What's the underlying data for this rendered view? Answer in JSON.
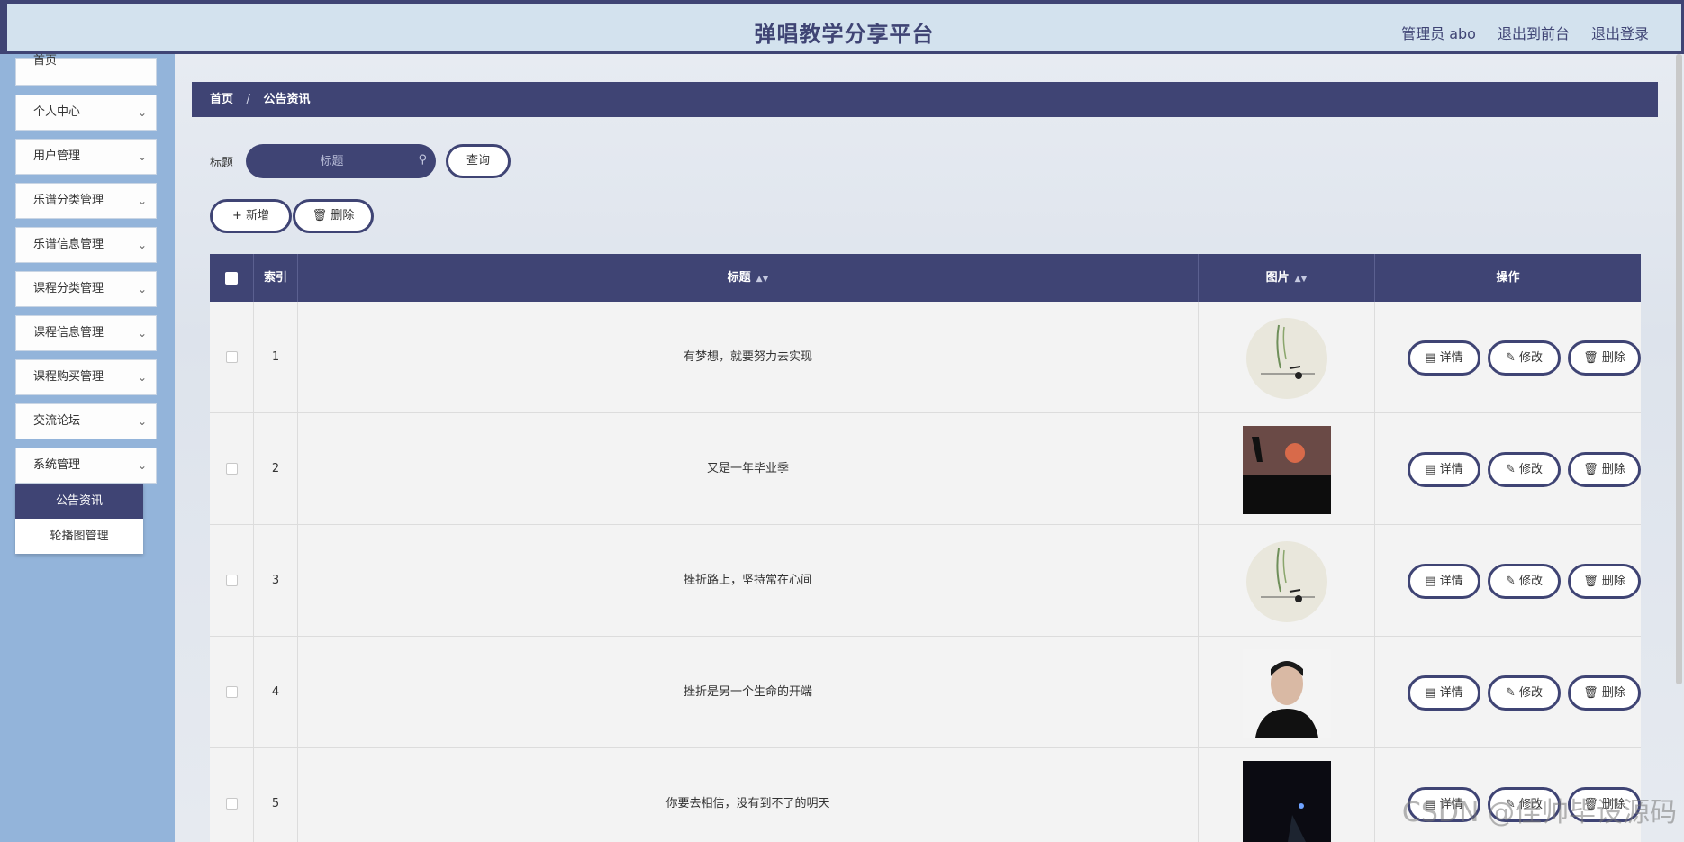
{
  "header": {
    "title": "弹唱教学分享平台",
    "user": "管理员 abo",
    "link_front": "退出到前台",
    "link_logout": "退出登录"
  },
  "sidebar": {
    "items": [
      {
        "label": "首页"
      },
      {
        "label": "个人中心"
      },
      {
        "label": "用户管理"
      },
      {
        "label": "乐谱分类管理"
      },
      {
        "label": "乐谱信息管理"
      },
      {
        "label": "课程分类管理"
      },
      {
        "label": "课程信息管理"
      },
      {
        "label": "课程购买管理"
      },
      {
        "label": "交流论坛"
      },
      {
        "label": "系统管理"
      }
    ],
    "submenu": [
      {
        "label": "公告资讯",
        "active": true
      },
      {
        "label": "轮播图管理"
      }
    ]
  },
  "breadcrumb": {
    "home": "首页",
    "separator": "/",
    "current": "公告资讯"
  },
  "search": {
    "label": "标题",
    "placeholder": "标题",
    "query_button": "查询"
  },
  "toolbar": {
    "add_label": "新增",
    "delete_label": "删除"
  },
  "table": {
    "headers": {
      "index": "索引",
      "title": "标题",
      "image": "图片",
      "actions": "操作"
    },
    "rows": [
      {
        "index": "1",
        "title": "有梦想，就要努力去实现",
        "image": "willow-circle"
      },
      {
        "index": "2",
        "title": "又是一年毕业季",
        "image": "sunset-silhouette"
      },
      {
        "index": "3",
        "title": "挫折路上，坚持常在心间",
        "image": "willow-circle"
      },
      {
        "index": "4",
        "title": "挫折是另一个生命的开端",
        "image": "man-portrait"
      },
      {
        "index": "5",
        "title": "你要去相信，没有到不了的明天",
        "image": "night-dark"
      }
    ],
    "row_actions": {
      "detail": "详情",
      "edit": "修改",
      "delete": "删除"
    }
  },
  "watermark": "CSDN @佳帅毕设源码",
  "colors": {
    "primary": "#3f4474",
    "header_bg": "#d3e2ee",
    "sidebar_bg": "#93b4da"
  }
}
